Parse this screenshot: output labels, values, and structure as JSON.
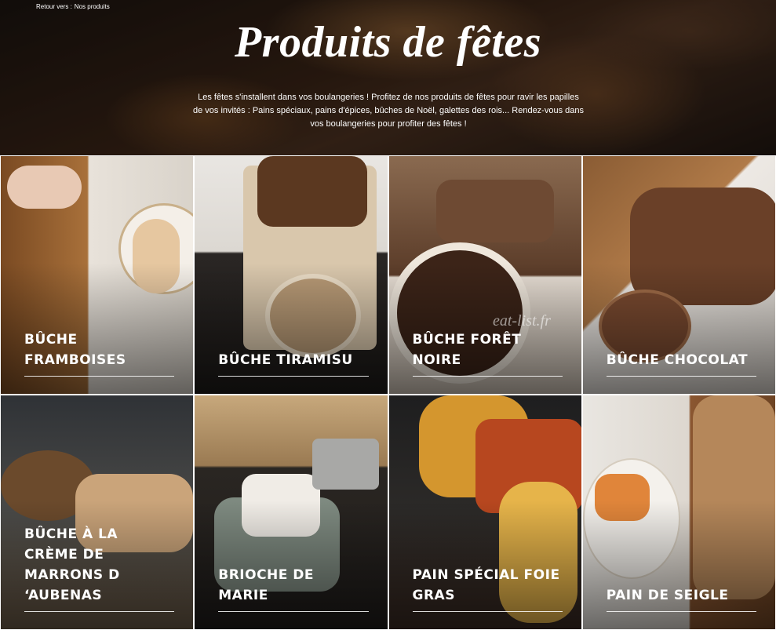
{
  "breadcrumb": {
    "prefix": "Retour vers :",
    "link": "Nos produits"
  },
  "hero": {
    "title": "Produits de fêtes",
    "description": "Les fêtes s'installent dans vos boulangeries ! Profitez de nos produits de fêtes pour ravir les papilles de vos invités : Pains spéciaux, pains d'épices, bûches de Noël, galettes des rois... Rendez-vous dans vos boulangeries pour profiter des fêtes !"
  },
  "watermark": "eat-list.fr",
  "products": [
    {
      "label": "BÛCHE FRAMBOISES"
    },
    {
      "label": "BÛCHE TIRAMISU"
    },
    {
      "label": "BÛCHE FORÊT NOIRE"
    },
    {
      "label": "BÛCHE CHOCOLAT"
    },
    {
      "label": "BÛCHE À LA CRÈME DE MARRONS D ‘AUBENAS"
    },
    {
      "label": "BRIOCHE DE MARIE"
    },
    {
      "label": "PAIN SPÉCIAL FOIE GRAS"
    },
    {
      "label": "PAIN DE SEIGLE"
    }
  ]
}
